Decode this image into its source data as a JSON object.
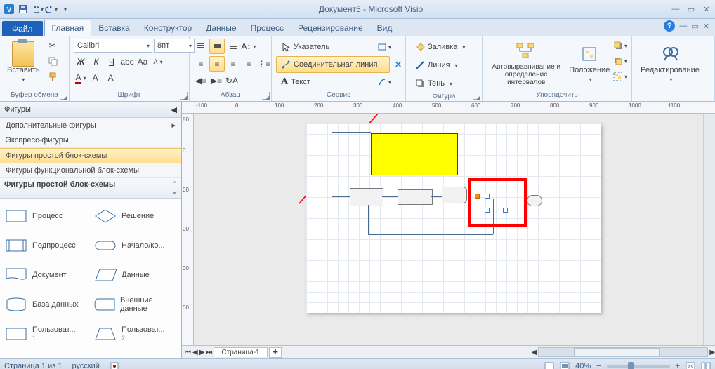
{
  "title": "Документ5 - Microsoft Visio",
  "qat": {
    "save": "save-icon",
    "undo": "undo-icon",
    "redo": "redo-icon"
  },
  "tabs": {
    "file": "Файл",
    "home": "Главная",
    "insert": "Вставка",
    "design": "Конструктор",
    "data": "Данные",
    "process": "Процесс",
    "review": "Рецензирование",
    "view": "Вид"
  },
  "ribbon": {
    "clipboard": {
      "label": "Буфер обмена",
      "paste": "Вставить"
    },
    "font": {
      "label": "Шрифт",
      "name": "Calibri",
      "size": "8пт"
    },
    "paragraph": {
      "label": "Абзац"
    },
    "service": {
      "label": "Сервис",
      "pointer": "Указатель",
      "connector": "Соединительная линия",
      "text": "Текст"
    },
    "figure": {
      "label": "Фигура",
      "fill": "Заливка",
      "line": "Линия",
      "shadow": "Тень"
    },
    "arrange": {
      "label": "Упорядочить",
      "auto": "Автовыравнивание и определение интервалов",
      "position": "Положение"
    },
    "editing": {
      "label": "",
      "find": "Редактирование"
    }
  },
  "shapes": {
    "title": "Фигуры",
    "more": "Дополнительные фигуры",
    "express": "Экспресс-фигуры",
    "simple": "Фигуры простой блок-схемы",
    "func": "Фигуры функциональной блок-схемы",
    "stencil_title": "Фигуры простой блок-схемы",
    "items": [
      {
        "l": "Процесс",
        "r": "Решение"
      },
      {
        "l": "Подпроцесс",
        "r": "Начало/ко..."
      },
      {
        "l": "Документ",
        "r": "Данные"
      },
      {
        "l": "База данных",
        "r": "Внешние данные"
      },
      {
        "l": "Пользоват...",
        "r": "Пользоват..."
      }
    ],
    "idx": [
      "1",
      "2"
    ]
  },
  "page_tabs": {
    "p1": "Страница-1"
  },
  "ruler": {
    "h": [
      "-100",
      "0",
      "100",
      "200",
      "300",
      "400",
      "500",
      "600",
      "700",
      "800",
      "900",
      "1000",
      "1100"
    ],
    "v": [
      "80",
      "0",
      "00",
      "00",
      "00",
      "00",
      "00"
    ]
  },
  "status": {
    "page": "Страница 1 из 1",
    "lang": "русский",
    "zoom": "40%"
  }
}
